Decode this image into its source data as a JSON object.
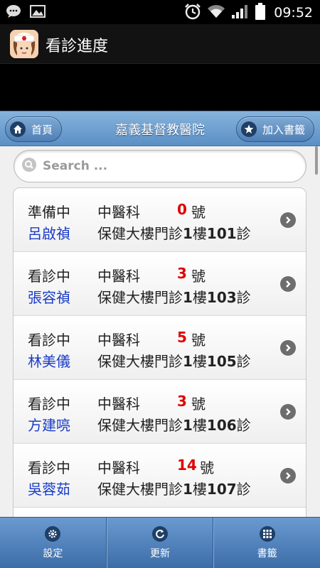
{
  "status_bar": {
    "time": "09:52",
    "icons": [
      "chat-icon",
      "image-icon",
      "alarm-icon",
      "wifi-icon",
      "signal-icon",
      "battery-icon"
    ]
  },
  "app": {
    "title": "看診進度",
    "icon": "nurse-app-icon"
  },
  "header": {
    "home_label": "首頁",
    "title": "嘉義基督教醫院",
    "bookmark_label": "加入書籤"
  },
  "search": {
    "placeholder": "Search ..."
  },
  "list": [
    {
      "status": "準備中",
      "dept": "中醫科",
      "number": "0",
      "number_suffix": "號",
      "doctor": "呂啟禎",
      "room_prefix": "保健大樓門診",
      "room_bold": "1",
      "room_mid": "樓",
      "room_num": "101",
      "room_suffix": "診"
    },
    {
      "status": "看診中",
      "dept": "中醫科",
      "number": "3",
      "number_suffix": "號",
      "doctor": "張容禎",
      "room_prefix": "保健大樓門診",
      "room_bold": "1",
      "room_mid": "樓",
      "room_num": "103",
      "room_suffix": "診"
    },
    {
      "status": "看診中",
      "dept": "中醫科",
      "number": "5",
      "number_suffix": "號",
      "doctor": "林美儀",
      "room_prefix": "保健大樓門診",
      "room_bold": "1",
      "room_mid": "樓",
      "room_num": "105",
      "room_suffix": "診"
    },
    {
      "status": "看診中",
      "dept": "中醫科",
      "number": "3",
      "number_suffix": "號",
      "doctor": "方建喨",
      "room_prefix": "保健大樓門診",
      "room_bold": "1",
      "room_mid": "樓",
      "room_num": "106",
      "room_suffix": "診"
    },
    {
      "status": "看診中",
      "dept": "中醫科",
      "number": "14",
      "number_suffix": "號",
      "doctor": "吳蓉茹",
      "room_prefix": "保健大樓門診",
      "room_bold": "1",
      "room_mid": "樓",
      "room_num": "107",
      "room_suffix": "診"
    }
  ],
  "bottom_nav": [
    {
      "label": "設定",
      "icon": "gear-icon"
    },
    {
      "label": "更新",
      "icon": "refresh-icon"
    },
    {
      "label": "書籤",
      "icon": "grid-icon"
    }
  ],
  "colors": {
    "header_blue": "#6b9bd0",
    "number_red": "#e00000",
    "doctor_blue": "#1a3cc8"
  }
}
